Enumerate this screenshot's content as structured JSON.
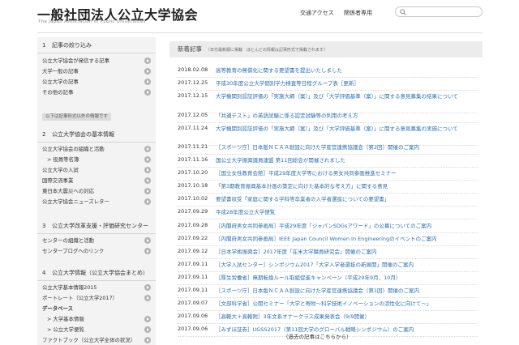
{
  "header": {
    "title": "一般社団法人公立大学協会",
    "subtitle": "The Japan Association of Public Universities",
    "nav": [
      "交通アクセス",
      "関係者専用"
    ],
    "search_placeholder": ""
  },
  "sidebar": {
    "sections": [
      {
        "num": "1",
        "title": "記事の絞り込み"
      },
      {
        "num": "2",
        "title": "公立大学協会の基本情報"
      },
      {
        "num": "3",
        "title": "公立大学改革支援・評価研究センター"
      },
      {
        "num": "4",
        "title": "公立大学情報（公立大学協会まとめ）"
      }
    ],
    "filter_items": [
      "公立大学協会が発信する記事",
      "大学一般の記事",
      "公立大学の記事",
      "その他の記事"
    ],
    "filter_tag": "以下は記事形式以外の情報です",
    "basic_items": [
      "公立大学協会の組織と活動",
      "> 役員等名簿",
      "公立大学の入試",
      "国際交流事業",
      "東日本大震災への対応",
      "公立大学協会ニューズレター"
    ],
    "center_items": [
      "センターの組織と活動",
      "センターブログへのリンク"
    ],
    "info_items": [
      "公立大学基本情報2015",
      "ポートレート（公立大学2017）",
      "データベース",
      "> 大学基本情報",
      "> 公立大学便覧",
      "ファクトブック（公立大学全体の状況）"
    ]
  },
  "main": {
    "heading": "新着記事",
    "note": "（日付最新順に掲載　ほとんどの情報は記事形式で掲載されます）",
    "news": [
      {
        "date": "2018.02.08",
        "title": "高等教育の無償化に関する要望書を提出いたしました"
      },
      {
        "date": "2017.12.25",
        "title": "平成30年度公立大学個別学力検査等日程グループ表［更新］"
      },
      {
        "date": "2017.12.15",
        "title": "大学機関別認証評価の「実施大綱（案）」及び「大学評価基準（案）」に関する意見募集の結果について"
      },
      {
        "date": "2017.12.05",
        "title": "「共通テスト」の英語試験に係る認定試験等の利用の考え方"
      },
      {
        "date": "2017.11.24",
        "title": "大学機関別認証評価の「実施大綱（案）」及び「大学評価基準（案）」に関する意見募集の実施について"
      },
      {
        "date": "2017.11.21",
        "title": "［スポーツ庁］日本版ＮＣＡＡ創設に向けた学産官連携協議会（第2回）開催のご案内"
      },
      {
        "date": "2017.11.16",
        "title": "国公立大学振興議員連盟 第11回総会が開催されました"
      },
      {
        "date": "2017.10.20",
        "title": "［国立女性教育会館］平成29年度大学等における男女共同参画推進セミナー"
      },
      {
        "date": "2017.10.18",
        "title": "「第3期教育振興基本計画の策定に向けた基本的な考え方」に関する意見"
      },
      {
        "date": "2017.10.02",
        "title": "要望書収受「家庭に関する学科等卒業者の入学者選抜についての要望書」"
      },
      {
        "date": "2017.09.29",
        "title": "平成28年度公立大学便覧"
      },
      {
        "date": "2017.09.28",
        "title": "［内閣府男女共同参画局］平成29年度「ジャパンSDGsアワード」の公募についてのご案内"
      },
      {
        "date": "2017.09.22",
        "title": "［内閣府男女共同参画局］IEEE Japan Council Women In Engineeringのイベントのご案内"
      },
      {
        "date": "2017.09.12",
        "title": "［日本学術振興会］2017年度「在米大学職員研究会」開催のご案内"
      },
      {
        "date": "2017.09.11",
        "title": "［大学入試センター］シンポジウム2017「大学入学者選抜の新展開」開催のご案内"
      },
      {
        "date": "2017.09.11",
        "title": "［厚生労働省］無期転換ルール取組促進キャンペーン（平成29年9月、10月）"
      },
      {
        "date": "2017.09.11",
        "title": "［スポーツ庁］日本版ＮＣＡＡ創設に向けた学産官連携協議会（第1回）開催のご案内"
      },
      {
        "date": "2017.09.07",
        "title": "［文部科学省］公開セミナー「大学と寄附～科学技術イノベーションの活性化に向けて～」"
      },
      {
        "date": "2017.09.06",
        "title": "［高軽大＋高轄附］3年文系オナークラス成果発表会（9/9開催）"
      },
      {
        "date": "2017.09.06",
        "title": "［みずほ証券］UGSS2017（第11回大学のグローバル戦略シンポジウム）のご案内"
      }
    ],
    "more": "（過去の記事はこちらから）"
  },
  "colors": {
    "link": "#2a6fb3",
    "sidebar_bg": "#f3f3f3",
    "heading_bg": "#ececec"
  }
}
